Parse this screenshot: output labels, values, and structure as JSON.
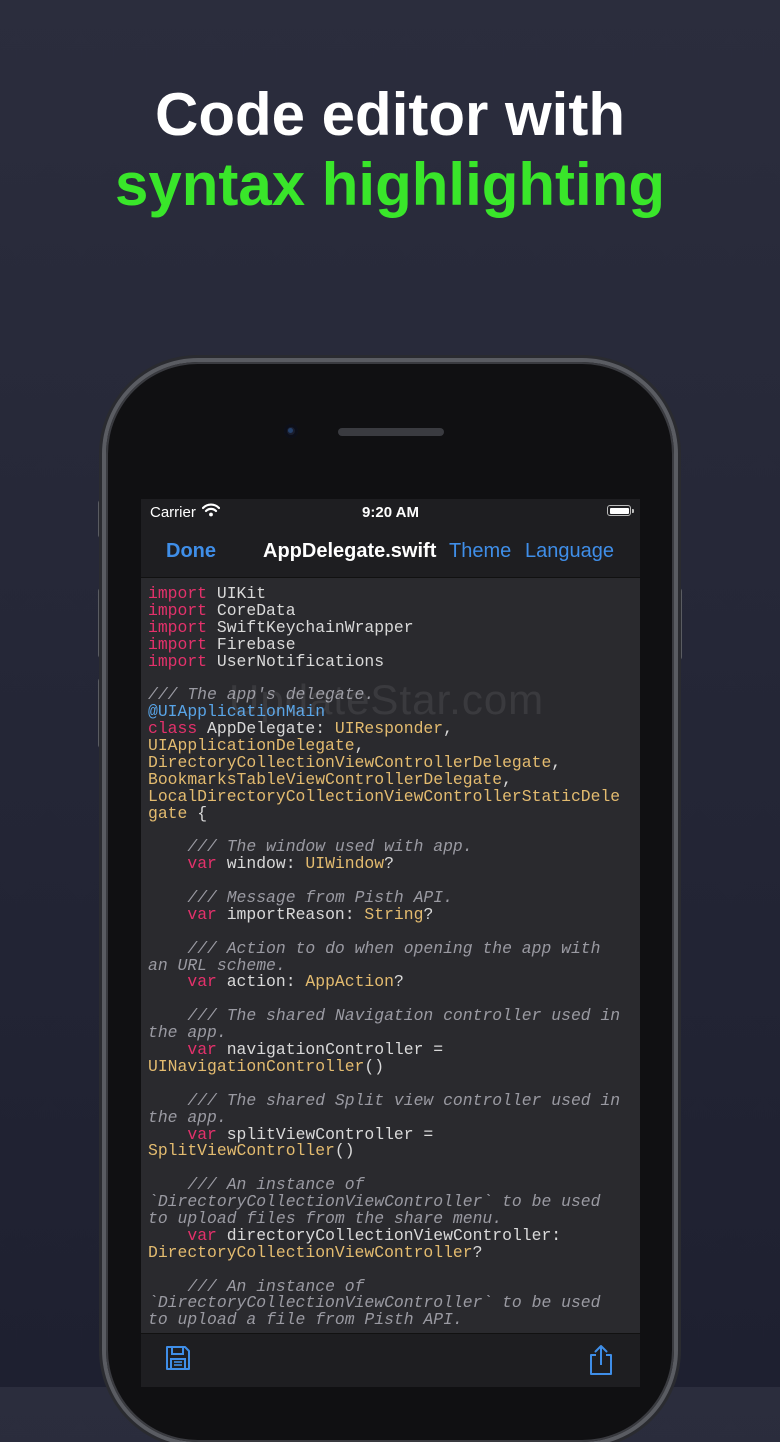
{
  "headline": {
    "line1": "Code editor with",
    "line2": "syntax highlighting"
  },
  "status_bar": {
    "carrier": "Carrier",
    "time": "9:20 AM"
  },
  "nav_bar": {
    "done": "Done",
    "title": "AppDelegate.swift",
    "theme": "Theme",
    "language": "Language"
  },
  "watermark": "UpdateStar.com",
  "colors": {
    "keyword": "#e4316b",
    "type": "#e3bb6f",
    "comment": "#9a9aa2",
    "attribute": "#58a4e7",
    "accent": "#3f8ee8",
    "headline_green": "#39e62a"
  },
  "code_lines": [
    [
      [
        "kw",
        "import"
      ],
      [
        "pl",
        " UIKit"
      ]
    ],
    [
      [
        "kw",
        "import"
      ],
      [
        "pl",
        " CoreData"
      ]
    ],
    [
      [
        "kw",
        "import"
      ],
      [
        "pl",
        " SwiftKeychainWrapper"
      ]
    ],
    [
      [
        "kw",
        "import"
      ],
      [
        "pl",
        " Firebase"
      ]
    ],
    [
      [
        "kw",
        "import"
      ],
      [
        "pl",
        " UserNotifications"
      ]
    ],
    [],
    [
      [
        "cm",
        "/// The app's delegate."
      ]
    ],
    [
      [
        "at",
        "@UIApplicationMain"
      ]
    ],
    [
      [
        "kw",
        "class"
      ],
      [
        "pl",
        " AppDelegate: "
      ],
      [
        "ty",
        "UIResponder"
      ],
      [
        "pl",
        ","
      ]
    ],
    [
      [
        "ty",
        "UIApplicationDelegate"
      ],
      [
        "pl",
        ","
      ]
    ],
    [
      [
        "ty",
        "DirectoryCollectionViewControllerDelegate"
      ],
      [
        "pl",
        ","
      ]
    ],
    [
      [
        "ty",
        "BookmarksTableViewControllerDelegate"
      ],
      [
        "pl",
        ","
      ]
    ],
    [
      [
        "ty",
        "LocalDirectoryCollectionViewControllerStaticDele"
      ]
    ],
    [
      [
        "ty",
        "gate"
      ],
      [
        "pl",
        " {"
      ]
    ],
    [],
    [
      [
        "pl",
        "    "
      ],
      [
        "cm",
        "/// The window used with app."
      ]
    ],
    [
      [
        "pl",
        "    "
      ],
      [
        "kw",
        "var"
      ],
      [
        "pl",
        " window: "
      ],
      [
        "ty",
        "UIWindow"
      ],
      [
        "pl",
        "?"
      ]
    ],
    [],
    [
      [
        "pl",
        "    "
      ],
      [
        "cm",
        "/// Message from Pisth API."
      ]
    ],
    [
      [
        "pl",
        "    "
      ],
      [
        "kw",
        "var"
      ],
      [
        "pl",
        " importReason: "
      ],
      [
        "ty",
        "String"
      ],
      [
        "pl",
        "?"
      ]
    ],
    [],
    [
      [
        "pl",
        "    "
      ],
      [
        "cm",
        "/// Action to do when opening the app with"
      ]
    ],
    [
      [
        "cm",
        "an URL scheme."
      ]
    ],
    [
      [
        "pl",
        "    "
      ],
      [
        "kw",
        "var"
      ],
      [
        "pl",
        " action: "
      ],
      [
        "ty",
        "AppAction"
      ],
      [
        "pl",
        "?"
      ]
    ],
    [],
    [
      [
        "pl",
        "    "
      ],
      [
        "cm",
        "/// The shared Navigation controller used in"
      ]
    ],
    [
      [
        "cm",
        "the app."
      ]
    ],
    [
      [
        "pl",
        "    "
      ],
      [
        "kw",
        "var"
      ],
      [
        "pl",
        " navigationController ="
      ]
    ],
    [
      [
        "ty",
        "UINavigationController"
      ],
      [
        "pl",
        "()"
      ]
    ],
    [],
    [
      [
        "pl",
        "    "
      ],
      [
        "cm",
        "/// The shared Split view controller used in"
      ]
    ],
    [
      [
        "cm",
        "the app."
      ]
    ],
    [
      [
        "pl",
        "    "
      ],
      [
        "kw",
        "var"
      ],
      [
        "pl",
        " splitViewController ="
      ]
    ],
    [
      [
        "ty",
        "SplitViewController"
      ],
      [
        "pl",
        "()"
      ]
    ],
    [],
    [
      [
        "pl",
        "    "
      ],
      [
        "cm",
        "/// An instance of"
      ]
    ],
    [
      [
        "cm",
        "`DirectoryCollectionViewController` to be used"
      ]
    ],
    [
      [
        "cm",
        "to upload files from the share menu."
      ]
    ],
    [
      [
        "pl",
        "    "
      ],
      [
        "kw",
        "var"
      ],
      [
        "pl",
        " directoryCollectionViewController:"
      ]
    ],
    [
      [
        "ty",
        "DirectoryCollectionViewController"
      ],
      [
        "pl",
        "?"
      ]
    ],
    [],
    [
      [
        "pl",
        "    "
      ],
      [
        "cm",
        "/// An instance of"
      ]
    ],
    [
      [
        "cm",
        "`DirectoryCollectionViewController` to be used"
      ]
    ],
    [
      [
        "cm",
        "to upload a file from Pisth API."
      ]
    ]
  ],
  "toolbar": {
    "left_icon": "save-icon",
    "right_icon": "share-icon"
  }
}
